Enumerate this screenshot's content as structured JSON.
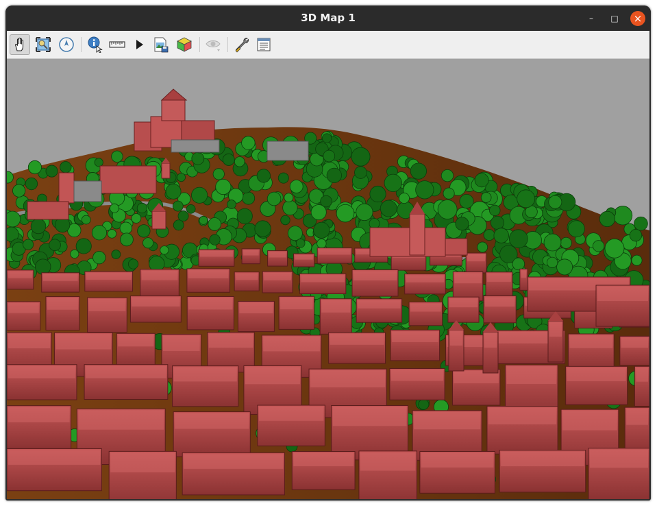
{
  "window": {
    "title": "3D Map 1",
    "controls": {
      "minimize": "–",
      "maximize": "□",
      "close": "×"
    }
  },
  "toolbar": {
    "buttons": [
      {
        "icon": "pan-hand-icon",
        "active": true
      },
      {
        "icon": "zoom-full-icon"
      },
      {
        "icon": "camera-north-icon"
      },
      {
        "icon": "identify-icon"
      },
      {
        "icon": "measure-line-icon"
      },
      {
        "icon": "animation-play-icon"
      },
      {
        "icon": "save-image-icon"
      },
      {
        "icon": "export-3d-scene-icon"
      },
      {
        "icon": "map-themes-icon",
        "disabled": true
      },
      {
        "icon": "configure-icon"
      },
      {
        "icon": "camera-menu-icon"
      }
    ]
  },
  "scene": {
    "sky_color": "#a0a0a0",
    "terrain_color": "#6e3a12",
    "building_color": "#b34a4a",
    "tree_color": "#1a7a1a"
  }
}
